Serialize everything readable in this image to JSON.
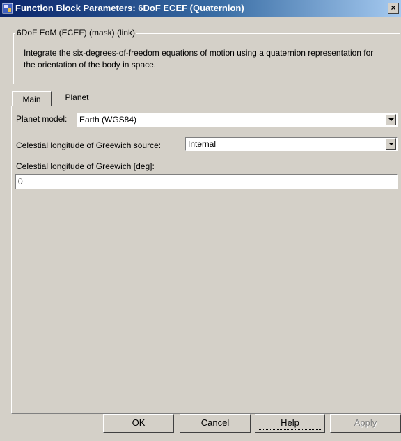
{
  "window": {
    "title": "Function Block Parameters: 6DoF ECEF (Quaternion)",
    "close_glyph": "×"
  },
  "mask": {
    "group_label": "6DoF EoM (ECEF) (mask) (link)",
    "description": "Integrate the six-degrees-of-freedom equations of motion using a quaternion representation for the orientation of the body in space."
  },
  "tabs": [
    {
      "label": "Main",
      "selected": false
    },
    {
      "label": "Planet",
      "selected": true
    }
  ],
  "params": {
    "planet_model_label": "Planet model:",
    "planet_model_value": "Earth (WGS84)",
    "longitude_source_label": "Celestial longitude of Greewich source:",
    "longitude_source_value": "Internal",
    "longitude_label": "Celestial longitude of Greewich [deg]:",
    "longitude_value": "0"
  },
  "buttons": {
    "ok": "OK",
    "cancel": "Cancel",
    "help": "Help",
    "apply": "Apply"
  }
}
